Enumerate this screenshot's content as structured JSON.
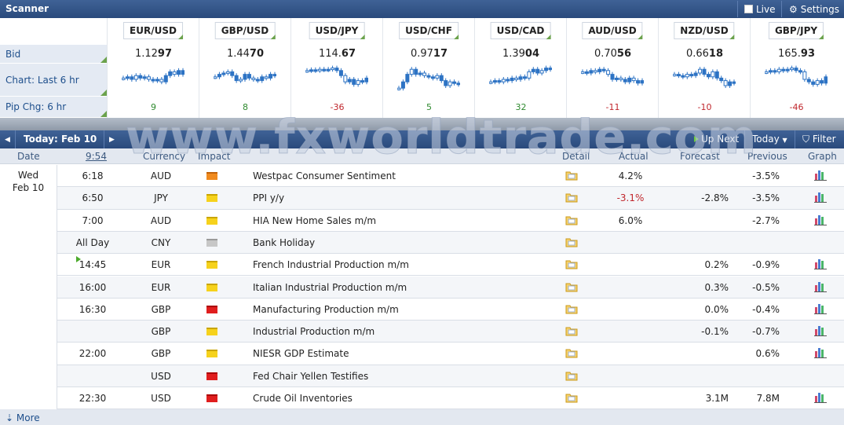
{
  "scanner": {
    "title": "Scanner",
    "live_label": "Live",
    "settings_label": "Settings",
    "row_labels": [
      "Bid",
      "Chart: Last 6 hr",
      "Pip Chg: 6 hr"
    ],
    "pairs": [
      {
        "symbol": "EUR/USD",
        "bid_pre": "1.12",
        "bid_big": "97",
        "pip": "9",
        "dir": "pos",
        "spark": [
          0.45,
          0.4,
          0.5,
          0.35,
          0.45,
          0.4,
          0.5,
          0.55,
          0.5,
          0.6,
          0.35,
          0.2,
          0.3,
          0.15,
          0.3
        ]
      },
      {
        "symbol": "GBP/USD",
        "bid_pre": "1.44",
        "bid_big": "70",
        "pip": "8",
        "dir": "pos",
        "spark": [
          0.4,
          0.3,
          0.25,
          0.2,
          0.35,
          0.55,
          0.5,
          0.3,
          0.45,
          0.5,
          0.55,
          0.4,
          0.45,
          0.3,
          0.35
        ]
      },
      {
        "symbol": "USD/JPY",
        "bid_pre": "114.",
        "bid_big": "67",
        "pip": "-36",
        "dir": "neg",
        "spark": [
          0.15,
          0.12,
          0.15,
          0.1,
          0.12,
          0.1,
          0.05,
          0.15,
          0.35,
          0.6,
          0.5,
          0.7,
          0.55,
          0.6,
          0.45
        ]
      },
      {
        "symbol": "USD/CHF",
        "bid_pre": "0.97",
        "bid_big": "17",
        "pip": "5",
        "dir": "pos",
        "spark": [
          0.85,
          0.6,
          0.3,
          0.1,
          0.3,
          0.25,
          0.35,
          0.4,
          0.45,
          0.35,
          0.55,
          0.75,
          0.6,
          0.65,
          0.7
        ]
      },
      {
        "symbol": "USD/CAD",
        "bid_pre": "1.39",
        "bid_big": "04",
        "pip": "32",
        "dir": "pos",
        "spark": [
          0.6,
          0.55,
          0.6,
          0.5,
          0.55,
          0.45,
          0.5,
          0.4,
          0.45,
          0.2,
          0.1,
          0.25,
          0.15,
          0.05,
          0.1
        ]
      },
      {
        "symbol": "AUD/USD",
        "bid_pre": "0.70",
        "bid_big": "56",
        "pip": "-11",
        "dir": "neg",
        "spark": [
          0.2,
          0.25,
          0.15,
          0.2,
          0.1,
          0.15,
          0.3,
          0.5,
          0.45,
          0.5,
          0.6,
          0.45,
          0.55,
          0.65,
          0.55
        ]
      },
      {
        "symbol": "NZD/USD",
        "bid_pre": "0.66",
        "bid_big": "18",
        "pip": "-10",
        "dir": "neg",
        "spark": [
          0.3,
          0.35,
          0.4,
          0.3,
          0.35,
          0.25,
          0.1,
          0.3,
          0.4,
          0.2,
          0.45,
          0.55,
          0.75,
          0.6,
          0.65
        ]
      },
      {
        "symbol": "GBP/JPY",
        "bid_pre": "165.",
        "bid_big": "93",
        "pip": "-46",
        "dir": "neg",
        "spark": [
          0.2,
          0.15,
          0.2,
          0.1,
          0.15,
          0.1,
          0.05,
          0.15,
          0.2,
          0.5,
          0.6,
          0.7,
          0.55,
          0.65,
          0.4
        ]
      }
    ]
  },
  "calendar": {
    "nav_date": "Today: Feb 10",
    "up_next": "Up Next",
    "today_label": "Today",
    "filter_label": "Filter",
    "headers": {
      "date": "Date",
      "time": "9:54",
      "currency": "Currency",
      "impact": "Impact",
      "detail": "Detail",
      "actual": "Actual",
      "forecast": "Forecast",
      "previous": "Previous",
      "graph": "Graph"
    },
    "day_weekday": "Wed",
    "day_date": "Feb 10",
    "watermark": "www.fxworldtrade.com",
    "events": [
      {
        "time": "6:18",
        "currency": "AUD",
        "impact": "mh",
        "event": "Westpac Consumer Sentiment",
        "actual": "4.2%",
        "actual_dir": "",
        "forecast": "",
        "previous": "-3.5%",
        "graph": true
      },
      {
        "time": "6:50",
        "currency": "JPY",
        "impact": "med",
        "event": "PPI y/y",
        "actual": "-3.1%",
        "actual_dir": "neg",
        "forecast": "-2.8%",
        "previous": "-3.5%",
        "graph": true
      },
      {
        "time": "7:00",
        "currency": "AUD",
        "impact": "med",
        "event": "HIA New Home Sales m/m",
        "actual": "6.0%",
        "actual_dir": "",
        "forecast": "",
        "previous": "-2.7%",
        "graph": true
      },
      {
        "time": "All Day",
        "currency": "CNY",
        "impact": "low",
        "event": "Bank Holiday",
        "actual": "",
        "actual_dir": "",
        "forecast": "",
        "previous": "",
        "graph": false
      },
      {
        "time": "14:45",
        "currency": "EUR",
        "impact": "med",
        "event": "French Industrial Production m/m",
        "actual": "",
        "actual_dir": "",
        "forecast": "0.2%",
        "previous": "-0.9%",
        "graph": true
      },
      {
        "time": "16:00",
        "currency": "EUR",
        "impact": "med",
        "event": "Italian Industrial Production m/m",
        "actual": "",
        "actual_dir": "",
        "forecast": "0.3%",
        "previous": "-0.5%",
        "graph": true
      },
      {
        "time": "16:30",
        "currency": "GBP",
        "impact": "high",
        "event": "Manufacturing Production m/m",
        "actual": "",
        "actual_dir": "",
        "forecast": "0.0%",
        "previous": "-0.4%",
        "graph": true
      },
      {
        "time": "",
        "currency": "GBP",
        "impact": "med",
        "event": "Industrial Production m/m",
        "actual": "",
        "actual_dir": "",
        "forecast": "-0.1%",
        "previous": "-0.7%",
        "graph": true
      },
      {
        "time": "22:00",
        "currency": "GBP",
        "impact": "med",
        "event": "NIESR GDP Estimate",
        "actual": "",
        "actual_dir": "",
        "forecast": "",
        "previous": "0.6%",
        "graph": true
      },
      {
        "time": "",
        "currency": "USD",
        "impact": "high",
        "event": "Fed Chair Yellen Testifies",
        "actual": "",
        "actual_dir": "",
        "forecast": "",
        "previous": "",
        "graph": false
      },
      {
        "time": "22:30",
        "currency": "USD",
        "impact": "high",
        "event": "Crude Oil Inventories",
        "actual": "",
        "actual_dir": "",
        "forecast": "3.1M",
        "previous": "7.8M",
        "graph": true
      }
    ],
    "more_label": "More"
  },
  "colors": {
    "header_blue": "#2a4a7c",
    "positive": "#2f8a2f",
    "negative": "#c0272d",
    "candle": "#2d73c4"
  }
}
